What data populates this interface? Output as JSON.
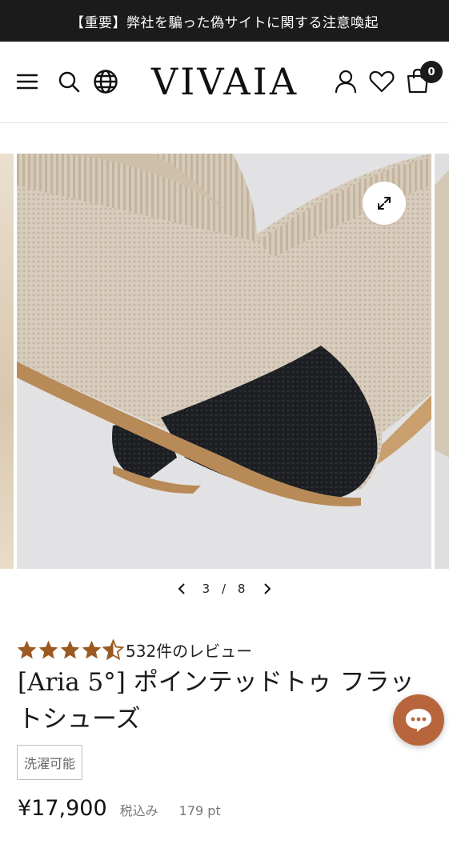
{
  "announcement": {
    "text": "【重要】弊社を騙った偽サイトに関する注意喚起"
  },
  "header": {
    "brand": "VIVAIA",
    "icons": [
      "menu-icon",
      "search-icon",
      "globe-icon",
      "account-icon",
      "heart-icon",
      "cart-icon"
    ],
    "cart_count": "0"
  },
  "gallery": {
    "current": "3",
    "separator": "/",
    "total": "8"
  },
  "product": {
    "rating": 4.5,
    "rating_color": "#9a5a22",
    "review_text": "532件のレビュー",
    "title": "[Aria 5°] ポインテッドトゥ フラットシューズ",
    "tag": "洗濯可能",
    "price": "¥17,900",
    "tax_label": "税込み",
    "points": "179 pt"
  },
  "chat": {
    "color": "#b8643d",
    "icon": "chat-bubble-icon"
  }
}
